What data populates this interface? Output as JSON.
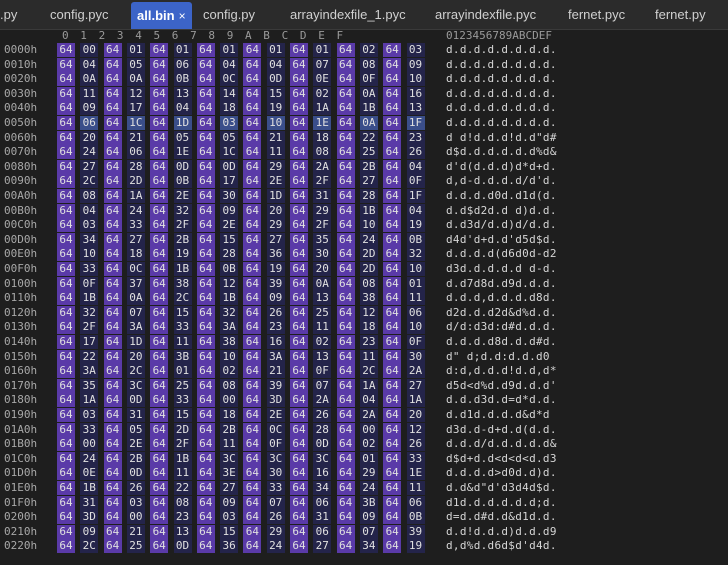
{
  "tabs": [
    {
      "label": ".py"
    },
    {
      "label": "config.pyc"
    },
    {
      "label": "all.bin",
      "close": "×"
    },
    {
      "label": "config.py"
    },
    {
      "label": "arrayindexfile_1.pyc"
    },
    {
      "label": "arrayindexfile.pyc"
    },
    {
      "label": "fernet.pyc"
    },
    {
      "label": "fernet.py"
    }
  ],
  "header": {
    "columns": [
      "0",
      "1",
      "2",
      "3",
      "4",
      "5",
      "6",
      "7",
      "8",
      "9",
      "A",
      "B",
      "C",
      "D",
      "E",
      "F"
    ],
    "ascii_header": "0123456789ABCDEF"
  },
  "rows": [
    {
      "addr": "0000h",
      "bytes": [
        "64",
        "00",
        "64",
        "01",
        "64",
        "01",
        "64",
        "01",
        "64",
        "01",
        "64",
        "01",
        "64",
        "02",
        "64",
        "03"
      ],
      "ascii": "d.d.d.d.d.d.d.d."
    },
    {
      "addr": "0010h",
      "bytes": [
        "64",
        "04",
        "64",
        "05",
        "64",
        "06",
        "64",
        "04",
        "64",
        "04",
        "64",
        "07",
        "64",
        "08",
        "64",
        "09"
      ],
      "ascii": "d.d.d.d.d.d.d.d."
    },
    {
      "addr": "0020h",
      "bytes": [
        "64",
        "0A",
        "64",
        "0A",
        "64",
        "0B",
        "64",
        "0C",
        "64",
        "0D",
        "64",
        "0E",
        "64",
        "0F",
        "64",
        "10"
      ],
      "ascii": "d.d.d.d.d.d.d.d."
    },
    {
      "addr": "0030h",
      "bytes": [
        "64",
        "11",
        "64",
        "12",
        "64",
        "13",
        "64",
        "14",
        "64",
        "15",
        "64",
        "02",
        "64",
        "0A",
        "64",
        "16"
      ],
      "ascii": "d.d.d.d.d.d.d.d."
    },
    {
      "addr": "0040h",
      "bytes": [
        "64",
        "09",
        "64",
        "17",
        "64",
        "04",
        "64",
        "18",
        "64",
        "19",
        "64",
        "1A",
        "64",
        "1B",
        "64",
        "13"
      ],
      "ascii": "d.d.d.d.d.d.d.d."
    },
    {
      "addr": "0050h",
      "bytes": [
        "64",
        "06",
        "64",
        "1C",
        "64",
        "1D",
        "64",
        "03",
        "64",
        "10",
        "64",
        "1E",
        "64",
        "0A",
        "64",
        "1F"
      ],
      "ascii": "d.d.d.d.d.d.d.d."
    },
    {
      "addr": "0060h",
      "bytes": [
        "64",
        "20",
        "64",
        "21",
        "64",
        "05",
        "64",
        "05",
        "64",
        "21",
        "64",
        "18",
        "64",
        "22",
        "64",
        "23"
      ],
      "ascii": "d d!d.d.d!d.d\"d#"
    },
    {
      "addr": "0070h",
      "bytes": [
        "64",
        "24",
        "64",
        "06",
        "64",
        "1E",
        "64",
        "1C",
        "64",
        "11",
        "64",
        "08",
        "64",
        "25",
        "64",
        "26"
      ],
      "ascii": "d$d.d.d.d.d.d%d&"
    },
    {
      "addr": "0080h",
      "bytes": [
        "64",
        "27",
        "64",
        "28",
        "64",
        "0D",
        "64",
        "0D",
        "64",
        "29",
        "64",
        "2A",
        "64",
        "2B",
        "64",
        "04"
      ],
      "ascii": "d'd(d.d.d)d*d+d."
    },
    {
      "addr": "0090h",
      "bytes": [
        "64",
        "2C",
        "64",
        "2D",
        "64",
        "0B",
        "64",
        "17",
        "64",
        "2E",
        "64",
        "2F",
        "64",
        "27",
        "64",
        "0F"
      ],
      "ascii": "d,d-d.d.d.d/d'd."
    },
    {
      "addr": "00A0h",
      "bytes": [
        "64",
        "08",
        "64",
        "1A",
        "64",
        "2E",
        "64",
        "30",
        "64",
        "1D",
        "64",
        "31",
        "64",
        "28",
        "64",
        "1F"
      ],
      "ascii": "d.d.d.d0d.d1d(d."
    },
    {
      "addr": "00B0h",
      "bytes": [
        "64",
        "04",
        "64",
        "24",
        "64",
        "32",
        "64",
        "09",
        "64",
        "20",
        "64",
        "29",
        "64",
        "1B",
        "64",
        "04"
      ],
      "ascii": "d.d$d2d.d d)d.d."
    },
    {
      "addr": "00C0h",
      "bytes": [
        "64",
        "03",
        "64",
        "33",
        "64",
        "2F",
        "64",
        "2E",
        "64",
        "29",
        "64",
        "2F",
        "64",
        "10",
        "64",
        "19"
      ],
      "ascii": "d.d3d/d.d)d/d.d."
    },
    {
      "addr": "00D0h",
      "bytes": [
        "64",
        "34",
        "64",
        "27",
        "64",
        "2B",
        "64",
        "15",
        "64",
        "27",
        "64",
        "35",
        "64",
        "24",
        "64",
        "0B"
      ],
      "ascii": "d4d'd+d.d'd5d$d."
    },
    {
      "addr": "00E0h",
      "bytes": [
        "64",
        "10",
        "64",
        "18",
        "64",
        "19",
        "64",
        "28",
        "64",
        "36",
        "64",
        "30",
        "64",
        "2D",
        "64",
        "32"
      ],
      "ascii": "d.d.d.d(d6d0d-d2"
    },
    {
      "addr": "00F0h",
      "bytes": [
        "64",
        "33",
        "64",
        "0C",
        "64",
        "1B",
        "64",
        "0B",
        "64",
        "19",
        "64",
        "20",
        "64",
        "2D",
        "64",
        "10"
      ],
      "ascii": "d3d.d.d.d.d d-d."
    },
    {
      "addr": "0100h",
      "bytes": [
        "64",
        "0F",
        "64",
        "37",
        "64",
        "38",
        "64",
        "12",
        "64",
        "39",
        "64",
        "0A",
        "64",
        "08",
        "64",
        "01"
      ],
      "ascii": "d.d7d8d.d9d.d.d."
    },
    {
      "addr": "0110h",
      "bytes": [
        "64",
        "1B",
        "64",
        "0A",
        "64",
        "2C",
        "64",
        "1B",
        "64",
        "09",
        "64",
        "13",
        "64",
        "38",
        "64",
        "11"
      ],
      "ascii": "d.d.d,d.d.d.d8d."
    },
    {
      "addr": "0120h",
      "bytes": [
        "64",
        "32",
        "64",
        "07",
        "64",
        "15",
        "64",
        "32",
        "64",
        "26",
        "64",
        "25",
        "64",
        "12",
        "64",
        "06"
      ],
      "ascii": "d2d.d.d2d&d%d.d."
    },
    {
      "addr": "0130h",
      "bytes": [
        "64",
        "2F",
        "64",
        "3A",
        "64",
        "33",
        "64",
        "3A",
        "64",
        "23",
        "64",
        "11",
        "64",
        "18",
        "64",
        "10"
      ],
      "ascii": "d/d:d3d:d#d.d.d."
    },
    {
      "addr": "0140h",
      "bytes": [
        "64",
        "17",
        "64",
        "1D",
        "64",
        "11",
        "64",
        "38",
        "64",
        "16",
        "64",
        "02",
        "64",
        "23",
        "64",
        "0F"
      ],
      "ascii": "d.d.d.d8d.d.d#d."
    },
    {
      "addr": "0150h",
      "bytes": [
        "64",
        "22",
        "64",
        "20",
        "64",
        "3B",
        "64",
        "10",
        "64",
        "3A",
        "64",
        "13",
        "64",
        "11",
        "64",
        "30"
      ],
      "ascii": "d\" d;d.d:d.d.d0"
    },
    {
      "addr": "0160h",
      "bytes": [
        "64",
        "3A",
        "64",
        "2C",
        "64",
        "01",
        "64",
        "02",
        "64",
        "21",
        "64",
        "0F",
        "64",
        "2C",
        "64",
        "2A"
      ],
      "ascii": "d:d,d.d.d!d.d,d*"
    },
    {
      "addr": "0170h",
      "bytes": [
        "64",
        "35",
        "64",
        "3C",
        "64",
        "25",
        "64",
        "08",
        "64",
        "39",
        "64",
        "07",
        "64",
        "1A",
        "64",
        "27"
      ],
      "ascii": "d5d<d%d.d9d.d.d'"
    },
    {
      "addr": "0180h",
      "bytes": [
        "64",
        "1A",
        "64",
        "0D",
        "64",
        "33",
        "64",
        "00",
        "64",
        "3D",
        "64",
        "2A",
        "64",
        "04",
        "64",
        "1A"
      ],
      "ascii": "d.d.d3d.d=d*d.d."
    },
    {
      "addr": "0190h",
      "bytes": [
        "64",
        "03",
        "64",
        "31",
        "64",
        "15",
        "64",
        "18",
        "64",
        "2E",
        "64",
        "26",
        "64",
        "2A",
        "64",
        "20"
      ],
      "ascii": "d.d1d.d.d.d&d*d "
    },
    {
      "addr": "01A0h",
      "bytes": [
        "64",
        "33",
        "64",
        "05",
        "64",
        "2D",
        "64",
        "2B",
        "64",
        "0C",
        "64",
        "28",
        "64",
        "00",
        "64",
        "12"
      ],
      "ascii": "d3d.d-d+d.d(d.d."
    },
    {
      "addr": "01B0h",
      "bytes": [
        "64",
        "00",
        "64",
        "2E",
        "64",
        "2F",
        "64",
        "11",
        "64",
        "0F",
        "64",
        "0D",
        "64",
        "02",
        "64",
        "26"
      ],
      "ascii": "d.d.d/d.d.d.d.d&"
    },
    {
      "addr": "01C0h",
      "bytes": [
        "64",
        "24",
        "64",
        "2B",
        "64",
        "1B",
        "64",
        "3C",
        "64",
        "3C",
        "64",
        "3C",
        "64",
        "01",
        "64",
        "33"
      ],
      "ascii": "d$d+d.d<d<d<d.d3"
    },
    {
      "addr": "01D0h",
      "bytes": [
        "64",
        "0E",
        "64",
        "0D",
        "64",
        "11",
        "64",
        "3E",
        "64",
        "30",
        "64",
        "16",
        "64",
        "29",
        "64",
        "1E"
      ],
      "ascii": "d.d.d.d>d0d.d)d."
    },
    {
      "addr": "01E0h",
      "bytes": [
        "64",
        "1B",
        "64",
        "26",
        "64",
        "22",
        "64",
        "27",
        "64",
        "33",
        "64",
        "34",
        "64",
        "24",
        "64",
        "11"
      ],
      "ascii": "d.d&d\"d'd3d4d$d."
    },
    {
      "addr": "01F0h",
      "bytes": [
        "64",
        "31",
        "64",
        "03",
        "64",
        "08",
        "64",
        "09",
        "64",
        "07",
        "64",
        "06",
        "64",
        "3B",
        "64",
        "06"
      ],
      "ascii": "d1d.d.d.d.d.d;d."
    },
    {
      "addr": "0200h",
      "bytes": [
        "64",
        "3D",
        "64",
        "00",
        "64",
        "23",
        "64",
        "03",
        "64",
        "26",
        "64",
        "31",
        "64",
        "09",
        "64",
        "0B"
      ],
      "ascii": "d=d.d#d.d&d1d.d."
    },
    {
      "addr": "0210h",
      "bytes": [
        "64",
        "09",
        "64",
        "21",
        "64",
        "13",
        "64",
        "15",
        "64",
        "29",
        "64",
        "06",
        "64",
        "07",
        "64",
        "39"
      ],
      "ascii": "d.d!d.d.d)d.d.d9"
    },
    {
      "addr": "0220h",
      "bytes": [
        "64",
        "2C",
        "64",
        "25",
        "64",
        "0D",
        "64",
        "36",
        "64",
        "24",
        "64",
        "27",
        "64",
        "34",
        "64",
        "19"
      ],
      "ascii": "d,d%d.d6d$d'd4d."
    }
  ]
}
